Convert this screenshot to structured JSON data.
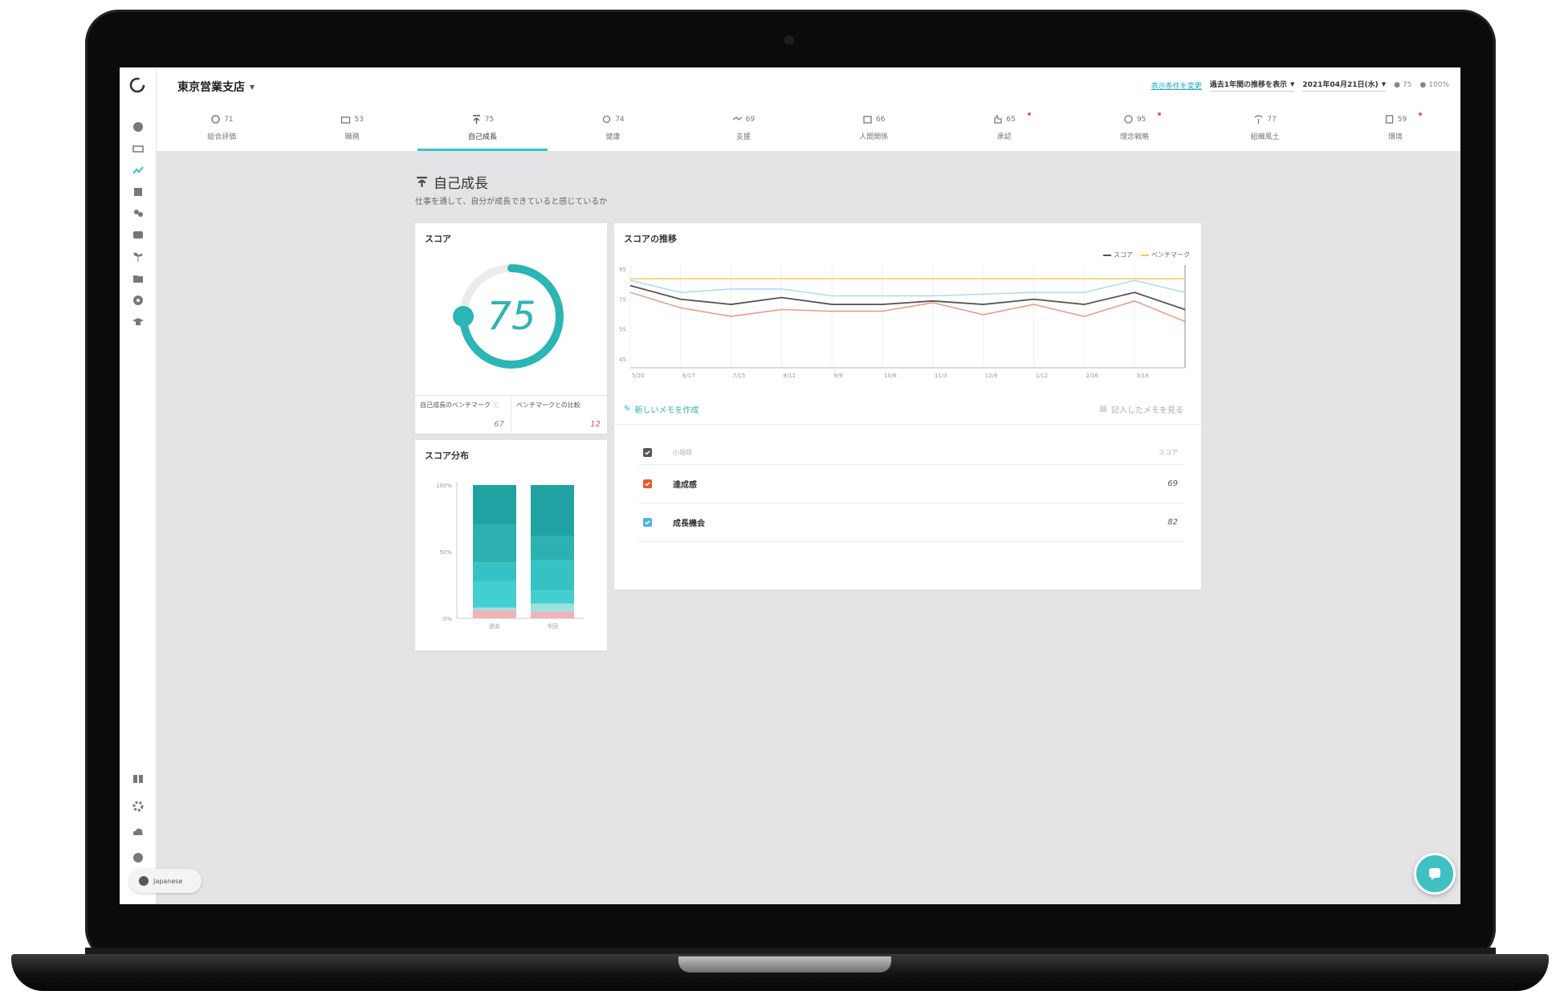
{
  "header": {
    "org_name": "東京営業支店",
    "link_text": "表示条件を変更",
    "period_select": "過去1年間の推移を表示",
    "date_select": "2021年04月21日(水)",
    "user_count": "75",
    "response_rate": "100%"
  },
  "tabs": [
    {
      "label": "総合評価",
      "score": "71",
      "icon": "circle-icon",
      "dot": false
    },
    {
      "label": "職務",
      "score": "53",
      "icon": "briefcase-icon",
      "dot": false
    },
    {
      "label": "自己成長",
      "score": "75",
      "icon": "sprout-icon",
      "dot": false,
      "active": true
    },
    {
      "label": "健康",
      "score": "74",
      "icon": "heart-icon",
      "dot": false
    },
    {
      "label": "支援",
      "score": "69",
      "icon": "handshake-icon",
      "dot": false
    },
    {
      "label": "人間関係",
      "score": "66",
      "icon": "people-icon",
      "dot": false
    },
    {
      "label": "承認",
      "score": "65",
      "icon": "thumb-icon",
      "dot": true
    },
    {
      "label": "理念戦略",
      "score": "95",
      "icon": "compass-icon",
      "dot": true
    },
    {
      "label": "組織風土",
      "score": "77",
      "icon": "tree-icon",
      "dot": false
    },
    {
      "label": "環境",
      "score": "59",
      "icon": "building-icon",
      "dot": true
    }
  ],
  "page": {
    "title": "自己成長",
    "description": "仕事を通して、自分が成長できていると感じているか"
  },
  "score_card": {
    "title": "スコア",
    "value": 75,
    "sub_left_label": "自己成長のベンチマーク",
    "sub_left_value": "67",
    "sub_right_label": "ベンチマークとの比較",
    "sub_right_value": "12"
  },
  "trend_card": {
    "title": "スコアの推移",
    "legend": [
      "スコア",
      "ベンチマーク"
    ],
    "new_memo": "新しいメモを作成",
    "memo_list": "記入したメモを見る"
  },
  "factors": {
    "header_name": "小項目",
    "header_score": "スコア",
    "rows": [
      {
        "name": "達成感",
        "value": "69",
        "color": "#e8572f"
      },
      {
        "name": "成長機会",
        "value": "82",
        "color": "#4db3e6"
      }
    ]
  },
  "dist_card": {
    "title": "スコア分布"
  },
  "footer": {
    "language": "Japanese"
  },
  "colors": {
    "accent": "#3fc1c3",
    "score_line": "#555555",
    "benchmark_line": "#f2c94c",
    "orange_line": "#ef8f7e",
    "blue_line": "#a9d6f5"
  },
  "chart_data": [
    {
      "type": "line",
      "title": "スコアの推移",
      "x": [
        "5/20",
        "6/17",
        "7/15",
        "8/12",
        "9/9",
        "10/6",
        "11/3",
        "12/8",
        "1/12",
        "2/16",
        "3/16",
        ""
      ],
      "yticks": [
        "95",
        "75",
        "55",
        "45"
      ],
      "ylim": [
        40,
        100
      ],
      "series": [
        {
          "name": "スコア",
          "values": [
            88,
            80,
            77,
            81,
            77,
            77,
            79,
            77,
            80,
            77,
            84,
            74
          ]
        },
        {
          "name": "ベンチマーク",
          "values": [
            92,
            92,
            92,
            92,
            92,
            92,
            92,
            92,
            92,
            92,
            92,
            92
          ]
        },
        {
          "values": [
            91,
            84,
            86,
            86,
            82,
            82,
            82,
            83,
            84,
            84,
            91,
            84
          ]
        },
        {
          "values": [
            84,
            75,
            70,
            74,
            73,
            73,
            78,
            71,
            77,
            70,
            79,
            67
          ]
        }
      ]
    },
    {
      "type": "bar",
      "title": "スコア分布",
      "categories": [
        "過去",
        "今回"
      ],
      "yticks": [
        "100%",
        "50%",
        "0%"
      ],
      "ylim": [
        0,
        100
      ],
      "series": [
        {
          "values": [
            6,
            5
          ]
        },
        {
          "values": [
            2,
            6
          ]
        },
        {
          "values": [
            20,
            10
          ]
        },
        {
          "values": [
            14,
            23
          ]
        },
        {
          "values": [
            28,
            18
          ]
        },
        {
          "values": [
            30,
            38
          ]
        }
      ],
      "colors": [
        "#f0b3b8",
        "#9ee0e0",
        "#43cfcf",
        "#36c2c2",
        "#2db0b0",
        "#21a2a2"
      ]
    }
  ]
}
